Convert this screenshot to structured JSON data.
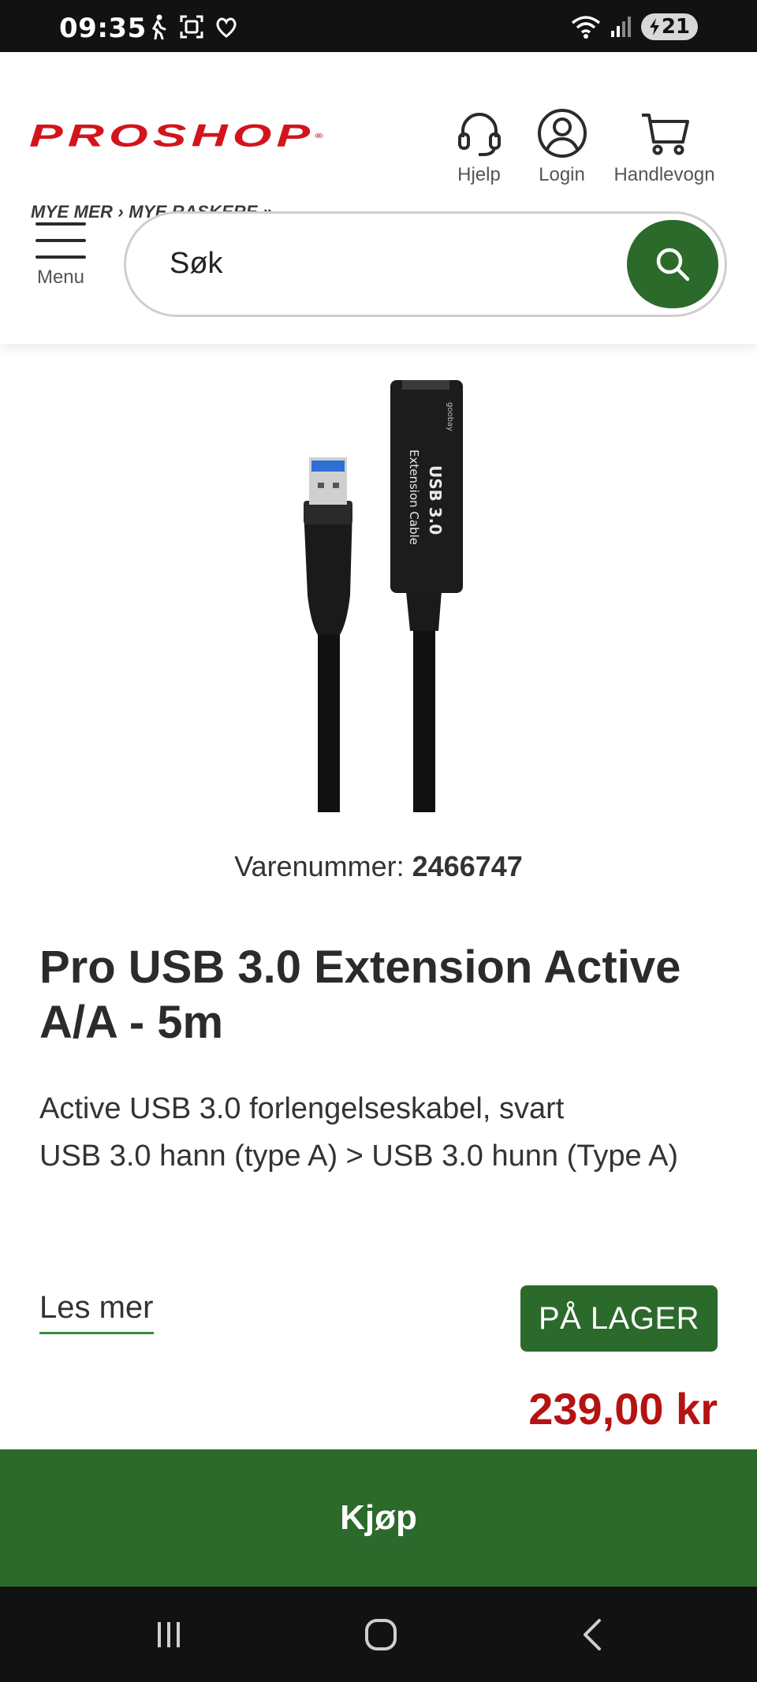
{
  "status_bar": {
    "time": "09:35",
    "battery": "21",
    "left_icons": [
      "walking-icon",
      "face-scan-icon",
      "care-icon"
    ],
    "right_icons": [
      "wifi-icon",
      "signal-icon",
      "battery-icon"
    ]
  },
  "header": {
    "logo_text": "PROSHOP",
    "logo_tagline": "MYE MER › MYE RASKERE »",
    "help_label": "Hjelp",
    "login_label": "Login",
    "cart_label": "Handlevogn",
    "menu_label": "Menu",
    "search_placeholder": "Søk"
  },
  "product": {
    "sku_label": "Varenummer:",
    "sku": "2466747",
    "title": "Pro USB 3.0 Extension Active A/A - 5m",
    "description_line1": "Active USB 3.0 forlengelseskabel, svart",
    "description_line2": "USB 3.0 hann (type A) > USB 3.0 hunn (Type A)",
    "read_more": "Les mer",
    "stock_status": "PÅ LAGER",
    "price": "239,00 kr",
    "image_text_line1": "USB 3.0",
    "image_text_line2": "Extension Cable",
    "image_brand": "goobay"
  },
  "actions": {
    "buy_label": "Kjøp"
  },
  "colors": {
    "brand_red": "#d3141c",
    "accent_green": "#2b6a2b",
    "price_red": "#b51212"
  }
}
